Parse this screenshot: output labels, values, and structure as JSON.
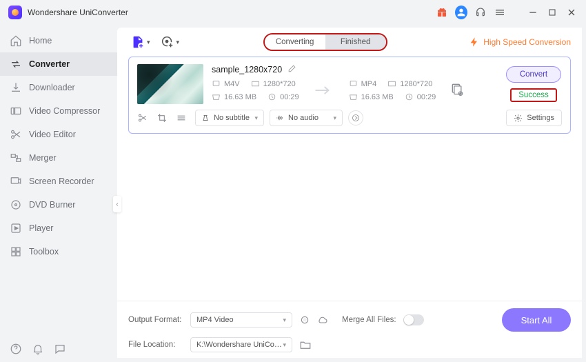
{
  "app": {
    "title": "Wondershare UniConverter"
  },
  "titlebar_icons": {
    "gift": "gift-icon",
    "user": "user-icon",
    "headset": "headset-icon",
    "menu": "menu-icon",
    "min": "minimize-icon",
    "max": "maximize-icon",
    "close": "close-icon"
  },
  "sidebar": {
    "items": [
      {
        "label": "Home"
      },
      {
        "label": "Converter"
      },
      {
        "label": "Downloader"
      },
      {
        "label": "Video Compressor"
      },
      {
        "label": "Video Editor"
      },
      {
        "label": "Merger"
      },
      {
        "label": "Screen Recorder"
      },
      {
        "label": "DVD Burner"
      },
      {
        "label": "Player"
      },
      {
        "label": "Toolbox"
      }
    ],
    "active_index": 1
  },
  "topbar": {
    "tabs": {
      "converting": "Converting",
      "finished": "Finished",
      "active": "finished"
    },
    "high_speed": "High Speed Conversion"
  },
  "item": {
    "filename": "sample_1280x720",
    "src": {
      "format": "M4V",
      "resolution": "1280*720",
      "size": "16.63 MB",
      "duration": "00:29"
    },
    "dst": {
      "format": "MP4",
      "resolution": "1280*720",
      "size": "16.63 MB",
      "duration": "00:29"
    },
    "subtitle": "No subtitle",
    "audio": "No audio",
    "settings_label": "Settings",
    "convert_label": "Convert",
    "status": "Success"
  },
  "bottom": {
    "output_format_label": "Output Format:",
    "output_format_value": "MP4 Video",
    "file_location_label": "File Location:",
    "file_location_value": "K:\\Wondershare UniConverter",
    "merge_label": "Merge All Files:",
    "start_all": "Start All"
  }
}
